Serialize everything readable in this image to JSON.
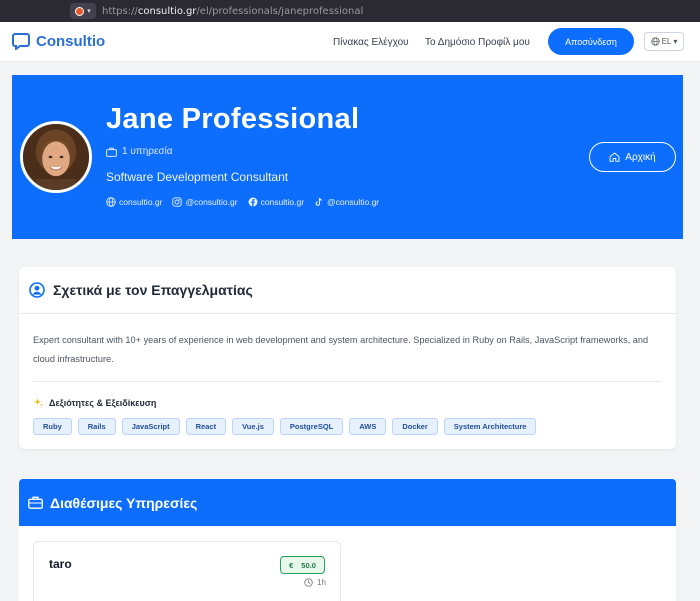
{
  "browser": {
    "url_scheme": "https://",
    "url_host": "consultio.gr",
    "url_path": "/el/professionals/janeprofessional"
  },
  "nav": {
    "brand": "Consultio",
    "links": [
      "Πίνακας Ελέγχου",
      "Το Δημόσιο Προφίλ μου"
    ],
    "logout": "Αποσύνδεση",
    "language": "EL"
  },
  "profile": {
    "name": "Jane Professional",
    "services_count": "1 υπηρεσία",
    "title": "Software Development Consultant",
    "social": [
      {
        "icon": "globe-icon",
        "label": "consultio.gr"
      },
      {
        "icon": "instagram-icon",
        "label": "@consultio.gr"
      },
      {
        "icon": "facebook-icon",
        "label": "consultio.gr"
      },
      {
        "icon": "tiktok-icon",
        "label": "@consultio.gr"
      }
    ],
    "home_button": "Αρχική"
  },
  "about": {
    "heading": "Σχετικά με τον Επαγγελματίας",
    "text": "Expert consultant with 10+ years of experience in web development and system architecture. Specialized in Ruby on Rails, JavaScript frameworks, and cloud infrastructure.",
    "skills_heading": "Δεξιότητες & Εξειδίκευση",
    "skills": [
      "Ruby",
      "Rails",
      "JavaScript",
      "React",
      "Vue.js",
      "PostgreSQL",
      "AWS",
      "Docker",
      "System Architecture"
    ]
  },
  "services": {
    "heading": "Διαθέσιμες Υπηρεσίες",
    "items": [
      {
        "name": "taro",
        "currency": "€",
        "price": "50.0",
        "duration": "1h"
      }
    ]
  },
  "colors": {
    "primary": "#0d6efd",
    "brand": "#2a6fd6",
    "price_green": "#22a35a"
  }
}
